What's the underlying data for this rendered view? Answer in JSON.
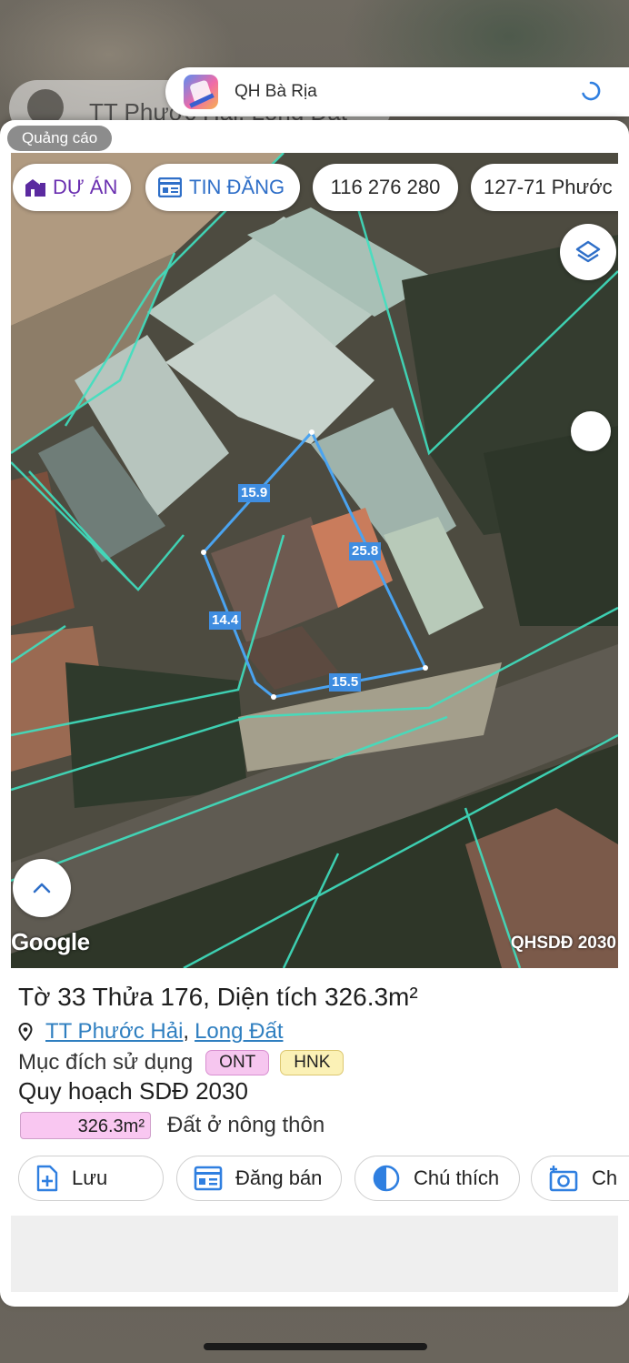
{
  "background": {
    "chip_text": "TT Phước Hải, Long Đất"
  },
  "app_bar": {
    "title": "QH Bà Rịa"
  },
  "ad_badge": "Quảng cáo",
  "map": {
    "chips": {
      "du_an": "DỰ ÁN",
      "tin_dang": "TIN ĐĂNG",
      "code": "116 276 280",
      "address": "127-71 Phước"
    },
    "edges": {
      "top": "15.9",
      "right": "25.8",
      "left": "14.4",
      "bottom": "15.5"
    },
    "attribution": "Google",
    "layer_name": "QHSDĐ 2030",
    "colors": {
      "parcel_line": "#4aa3f0",
      "boundary_line": "#3fe0c0"
    }
  },
  "parcel": {
    "title": "Tờ 33 Thửa 176, Diện tích 326.3m²",
    "ward": "TT Phước Hải",
    "district": "Long Đất",
    "separator": ",",
    "purpose_label": "Mục đích sử dụng",
    "tags": [
      "ONT",
      "HNK"
    ],
    "plan_title": "Quy hoạch SDĐ 2030",
    "plan_area": "326.3m²",
    "plan_desc": "Đất ở nông thôn"
  },
  "actions": {
    "save": "Lưu",
    "sell": "Đăng bán",
    "legend": "Chú thích",
    "camera": "Ch"
  }
}
